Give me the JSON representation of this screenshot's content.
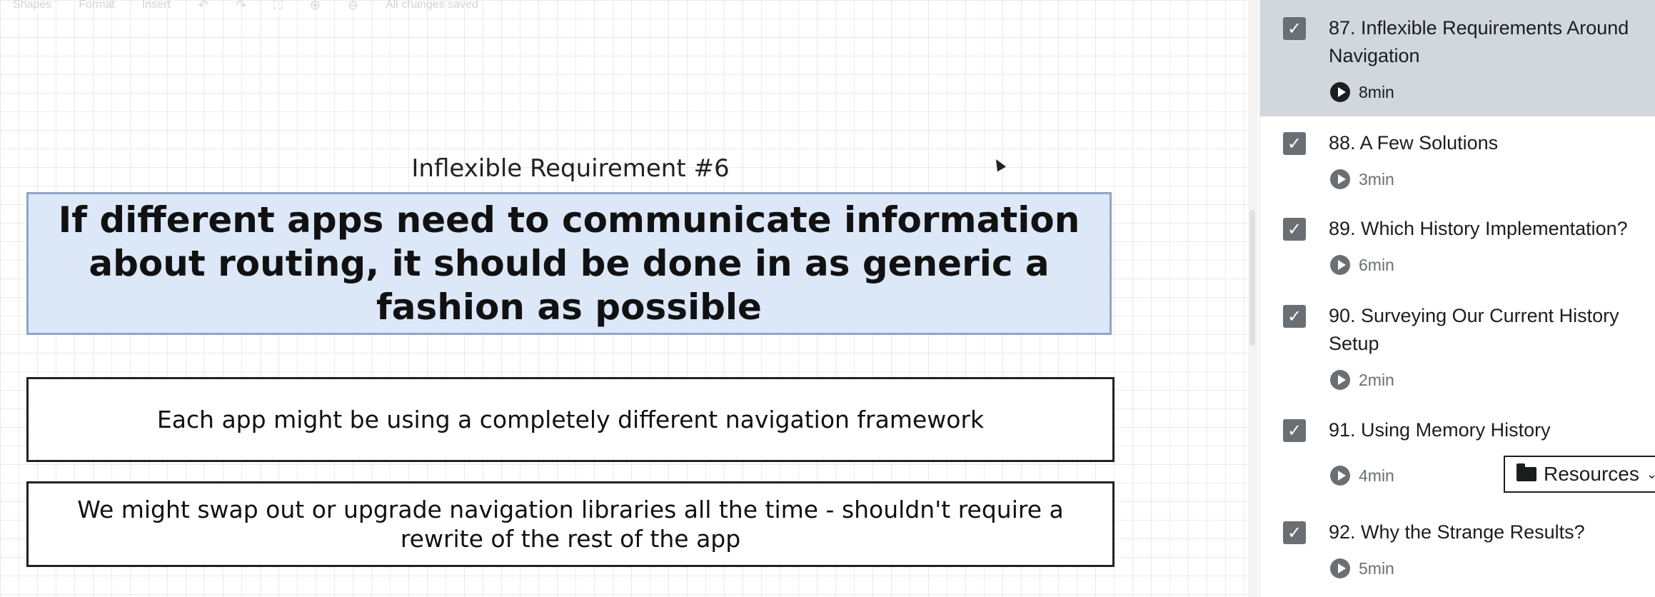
{
  "toolbar": {
    "shapes": "Shapes",
    "format": "Format",
    "insert": "Insert",
    "status": "All changes saved"
  },
  "diagram": {
    "title": "Inflexible Requirement #6",
    "main_text": "If different apps need to communicate information about routing, it should be done in as generic a fashion as possible",
    "box1_text": "Each app might be using a completely different navigation framework",
    "box2_text": "We might swap out or upgrade navigation libraries all the time - shouldn't require a rewrite of the rest of the app"
  },
  "lectures": [
    {
      "title": "87. Inflexible Requirements Around Navigation",
      "duration": "8min",
      "active": true,
      "completed": true
    },
    {
      "title": "88. A Few Solutions",
      "duration": "3min",
      "active": false,
      "completed": true
    },
    {
      "title": "89. Which History Implementation?",
      "duration": "6min",
      "active": false,
      "completed": true
    },
    {
      "title": "90. Surveying Our Current History Setup",
      "duration": "2min",
      "active": false,
      "completed": true
    },
    {
      "title": "91. Using Memory History",
      "duration": "4min",
      "active": false,
      "completed": true
    },
    {
      "title": "92. Why the Strange Results?",
      "duration": "5min",
      "active": false,
      "completed": true
    }
  ],
  "resources": {
    "label": "Resources"
  },
  "colors": {
    "active_row": "#d1d7dc",
    "checkbox": "#6a6f73",
    "main_box_fill": "#dce7f8",
    "main_box_border": "#8fa6c9"
  }
}
